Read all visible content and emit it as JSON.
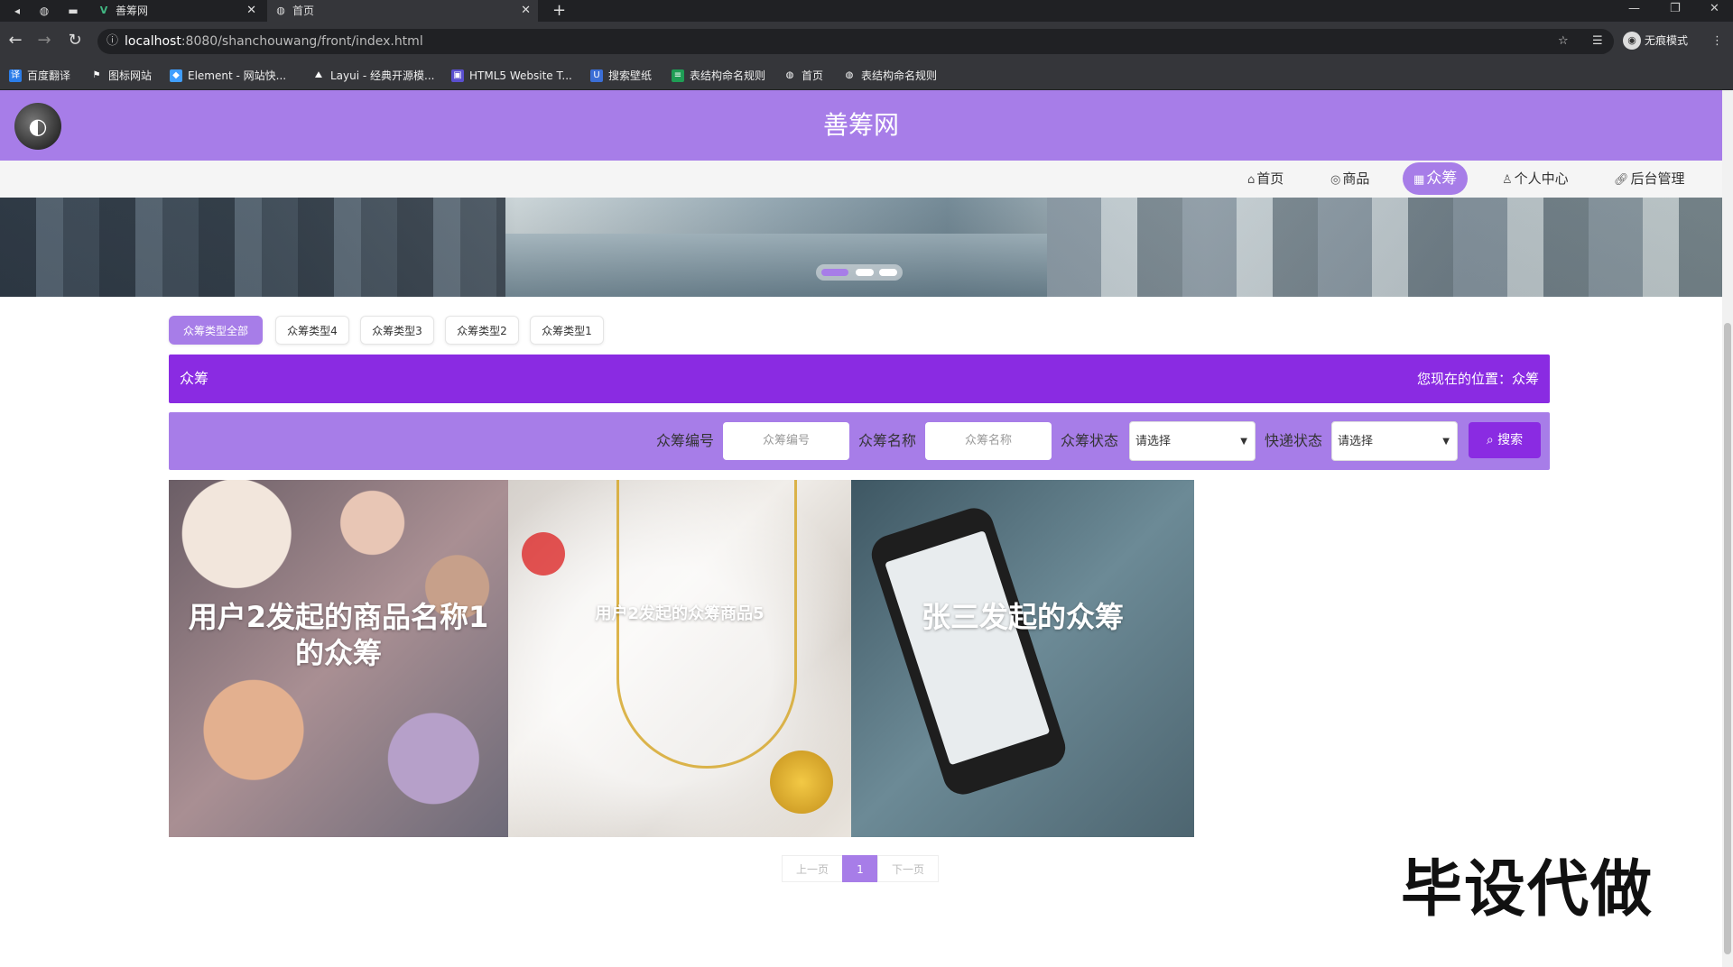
{
  "browser": {
    "tabs": [
      {
        "title": "善筹网",
        "favicon": "V"
      },
      {
        "title": "首页",
        "favicon": "globe"
      }
    ],
    "url_host": "localhost",
    "url_path": ":8080/shanchouwang/front/index.html",
    "profile_label": "无痕模式",
    "bookmarks": [
      {
        "label": "百度翻译",
        "color": "#2b7de9"
      },
      {
        "label": "图标网站",
        "color": "#555555"
      },
      {
        "label": "Element - 网站快...",
        "color": "#409eff"
      },
      {
        "label": "Layui - 经典开源模...",
        "color": "#555555"
      },
      {
        "label": "HTML5 Website T...",
        "color": "#5a4fcf"
      },
      {
        "label": "搜索壁纸",
        "color": "#3b6ed6"
      },
      {
        "label": "表结构命名规则",
        "color": "#1f9d55"
      },
      {
        "label": "首页",
        "color": "#555555"
      },
      {
        "label": "表结构命名规则",
        "color": "#555555"
      }
    ]
  },
  "site": {
    "title": "善筹网",
    "brand_color": "#a77de8",
    "accent_color": "#8a2be2"
  },
  "nav": [
    {
      "label": "首页",
      "icon": "home-icon"
    },
    {
      "label": "商品",
      "icon": "palette-icon"
    },
    {
      "label": "众筹",
      "icon": "grid-icon",
      "active": true
    },
    {
      "label": "个人中心",
      "icon": "user-icon"
    },
    {
      "label": "后台管理",
      "icon": "link-icon"
    }
  ],
  "type_tabs": [
    "众筹类型全部",
    "众筹类型4",
    "众筹类型3",
    "众筹类型2",
    "众筹类型1"
  ],
  "crumb": {
    "title": "众筹",
    "location": "您现在的位置：众筹"
  },
  "search": {
    "id_label": "众筹编号",
    "id_placeholder": "众筹编号",
    "name_label": "众筹名称",
    "name_placeholder": "众筹名称",
    "status_label": "众筹状态",
    "status_value": "请选择",
    "express_label": "快递状态",
    "express_value": "请选择",
    "button": "搜索"
  },
  "cards": [
    {
      "caption": "用户2发起的商品名称1的众筹"
    },
    {
      "caption": "用户2发起的众筹商品5"
    },
    {
      "caption": "张三发起的众筹"
    }
  ],
  "pager": {
    "prev": "上一页",
    "current": "1",
    "next": "下一页"
  },
  "watermark": "毕设代做"
}
